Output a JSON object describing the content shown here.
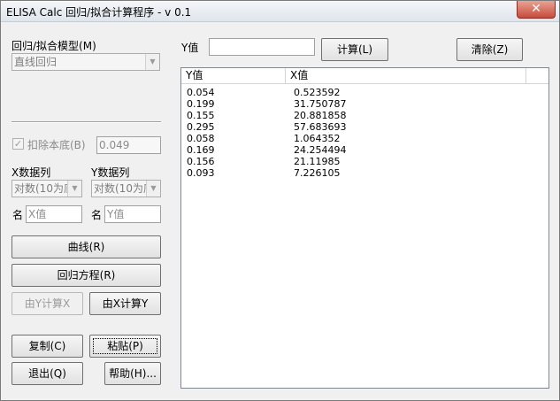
{
  "window": {
    "title": "ELISA Calc 回归/拟合计算程序 - v 0.1",
    "close_glyph": "✕"
  },
  "left": {
    "model_label": "回归/拟合模型(M)",
    "model_value": "直线回归",
    "subtract_bg_label": "扣除本底(B)",
    "subtract_bg_value": "0.049",
    "x_col_label": "X数据列",
    "y_col_label": "Y数据列",
    "x_col_value": "对数(10为底",
    "y_col_value": "对数(10为底",
    "name_label_x": "名",
    "name_label_y": "名",
    "x_name_placeholder": "X值",
    "y_name_placeholder": "Y值",
    "curve_btn": "曲线(R)",
    "equation_btn": "回归方程(R)",
    "calc_from_y_btn": "由Y计算X",
    "calc_from_x_btn": "由X计算Y",
    "copy_btn": "复制(C)",
    "paste_btn": "粘贴(P)",
    "exit_btn": "退出(Q)",
    "help_btn": "帮助(H)..."
  },
  "right": {
    "y_label": "Y值",
    "y_input_value": "",
    "calc_btn": "计算(L)",
    "clear_btn": "清除(Z)",
    "columns": [
      "Y值",
      "X值"
    ],
    "rows": [
      [
        "0.054",
        "0.523592"
      ],
      [
        "0.199",
        "31.750787"
      ],
      [
        "0.155",
        "20.881858"
      ],
      [
        "0.295",
        "57.683693"
      ],
      [
        "0.058",
        "1.064352"
      ],
      [
        "0.169",
        "24.254494"
      ],
      [
        "0.156",
        "21.11985"
      ],
      [
        "0.093",
        "7.226105"
      ]
    ]
  }
}
